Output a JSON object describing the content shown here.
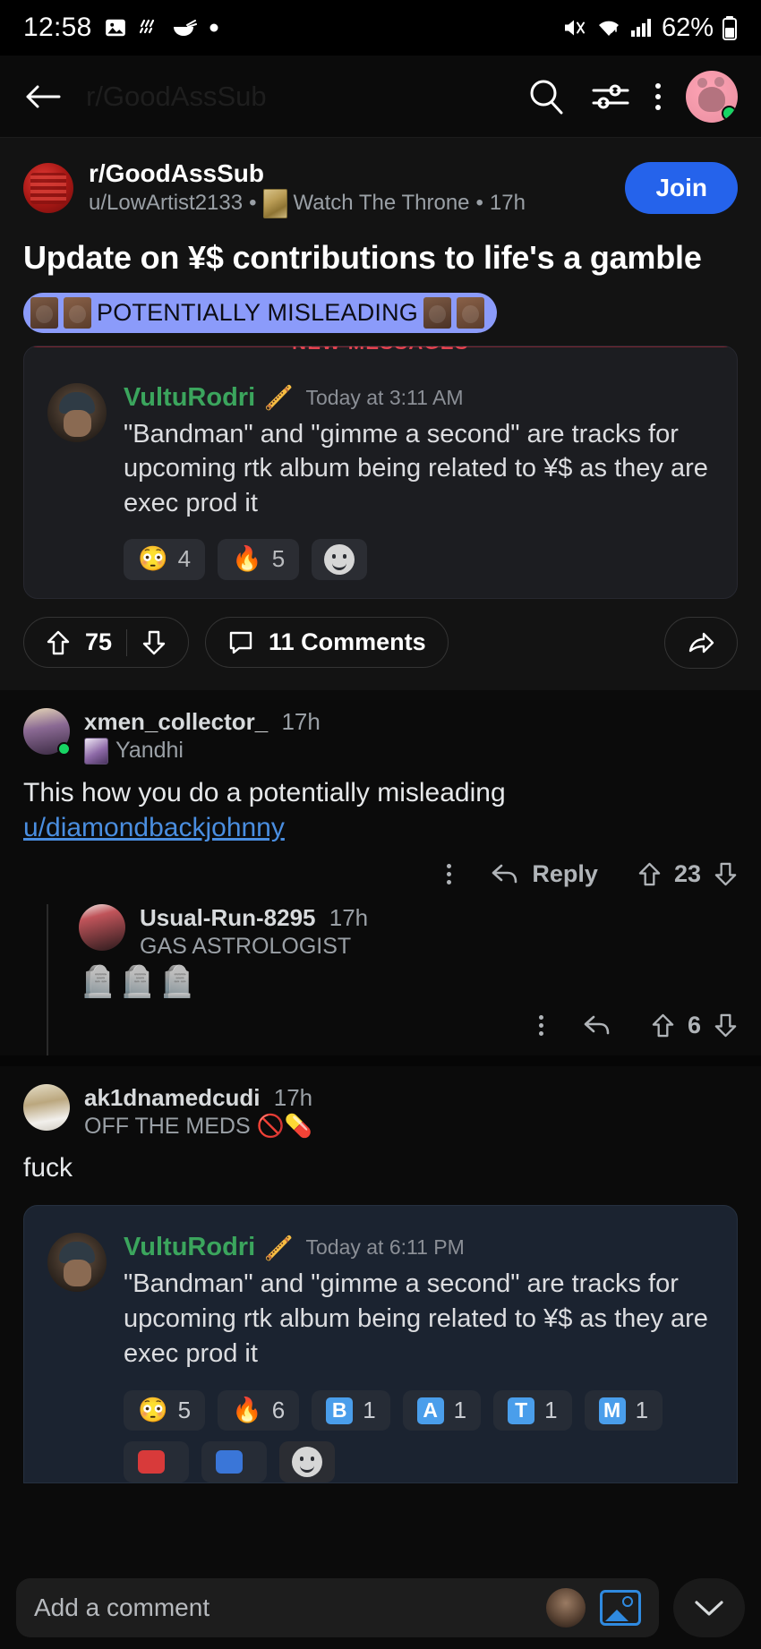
{
  "status_bar": {
    "time": "12:58",
    "battery": "62%",
    "icons": [
      "image-icon",
      "weather-icon",
      "noodles-icon",
      "dot-icon",
      "mute-icon",
      "wifi-icon",
      "signal-icon",
      "battery-icon"
    ]
  },
  "toolbar": {
    "back": "back-arrow-icon",
    "title": "r/GoodAssSub",
    "search": "search-icon",
    "sort": "sort-icon",
    "overflow": "more-vertical-icon",
    "avatar": "user-avatar"
  },
  "post": {
    "subreddit": "r/GoodAssSub",
    "author": "u/LowArtist2133",
    "separator1": "•",
    "flair_text": "Watch The Throne",
    "separator2": "•",
    "age": "17h",
    "join_label": "Join",
    "title": "Update on ¥$ contributions to life's a gamble",
    "post_flair": "POTENTIALLY MISLEADING",
    "upvotes": "75",
    "comments_label": "11 Comments",
    "share": "share-icon"
  },
  "embed_top": {
    "new_messages_label": "NEW MESSAGES",
    "username": "VultuRodri",
    "badge": "🪈",
    "timestamp": "Today at 3:11 AM",
    "text": "\"Bandman\" and \"gimme a second\" are tracks for upcoming rtk album being related to ¥$ as they are exec prod it",
    "reactions": [
      {
        "type": "emoji",
        "emoji": "😳",
        "count": "4"
      },
      {
        "type": "emoji",
        "emoji": "🔥",
        "count": "5"
      },
      {
        "type": "add",
        "emoji": "add-reaction-icon",
        "count": ""
      }
    ]
  },
  "embed_bottom": {
    "username": "VultuRodri",
    "badge": "🪈",
    "timestamp": "Today at 6:11 PM",
    "text": "\"Bandman\" and \"gimme a second\" are tracks for upcoming rtk album being related to ¥$ as they are exec prod it",
    "reactions": [
      {
        "type": "emoji",
        "emoji": "😳",
        "count": "5"
      },
      {
        "type": "emoji",
        "emoji": "🔥",
        "count": "6"
      },
      {
        "type": "letter",
        "emoji": "B",
        "count": "1"
      },
      {
        "type": "letter",
        "emoji": "A",
        "count": "1"
      },
      {
        "type": "letter",
        "emoji": "T",
        "count": "1"
      },
      {
        "type": "letter",
        "emoji": "M",
        "count": "1"
      }
    ]
  },
  "comments": [
    {
      "username": "xmen_collector_",
      "age": "17h",
      "flair": "Yandhi",
      "body_prefix": "This how you do a potentially misleading ",
      "body_link": "u/diamondbackjohnny",
      "reply_label": "Reply",
      "score": "23",
      "overflow": "more-vertical-icon"
    },
    {
      "username": "Usual-Run-8295",
      "age": "17h",
      "flair": "GAS ASTROLOGIST",
      "body": "🪦🪦🪦",
      "score": "6",
      "overflow": "more-vertical-icon"
    },
    {
      "username": "ak1dnamedcudi",
      "age": "17h",
      "flair": "OFF THE MEDS 🚫💊",
      "body": "fuck"
    }
  ],
  "bottom_bar": {
    "placeholder": "Add a comment",
    "image_button": "image-icon",
    "collapse_button": "chevron-down-icon"
  },
  "colors": {
    "accent_blue": "#2563eb",
    "link_blue": "#4a8ee0",
    "flair_pill": "#8b9bfa",
    "discord_green": "#3ba55d",
    "new_messages_red": "#e0434f",
    "online_green": "#17d464"
  }
}
